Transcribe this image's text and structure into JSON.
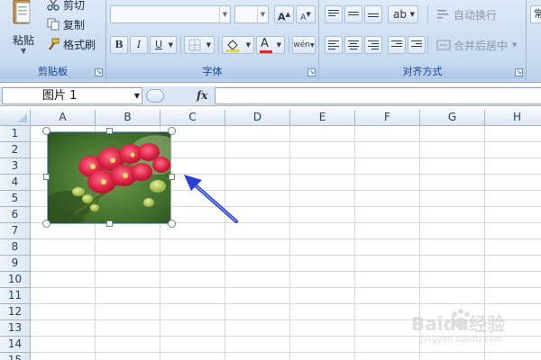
{
  "ribbon": {
    "clipboard": {
      "paste_label": "粘贴",
      "cut_label": "剪切",
      "copy_label": "复制",
      "format_painter_label": "格式刷",
      "group_label": "剪贴板"
    },
    "font": {
      "font_name_value": "",
      "font_size_value": "",
      "bold_label": "B",
      "italic_label": "I",
      "underline_label": "U",
      "fill_color": "#f5d900",
      "font_color": "#d62b2b",
      "group_label": "字体"
    },
    "alignment": {
      "wrap_text_label": "自动换行",
      "merge_center_label": "合并后居中",
      "group_label": "对齐方式"
    },
    "number": {
      "partial_label": "常"
    }
  },
  "formula_bar": {
    "name_box_value": "图片 1",
    "fx_label": "fx",
    "formula_value": ""
  },
  "grid": {
    "columns": [
      "A",
      "B",
      "C",
      "D",
      "E",
      "F",
      "G",
      "H"
    ],
    "rows": [
      "1",
      "2",
      "3",
      "4",
      "5",
      "6",
      "7",
      "8",
      "9",
      "10",
      "11",
      "12",
      "13",
      "14",
      "15"
    ]
  },
  "picture": {
    "subject": "red orchid flowers photo",
    "selected": true
  },
  "annotation": {
    "arrow_color": "#2a3fd6"
  },
  "watermark": {
    "brand": "Baidu经验",
    "url": "jingyan.baidu.com"
  }
}
